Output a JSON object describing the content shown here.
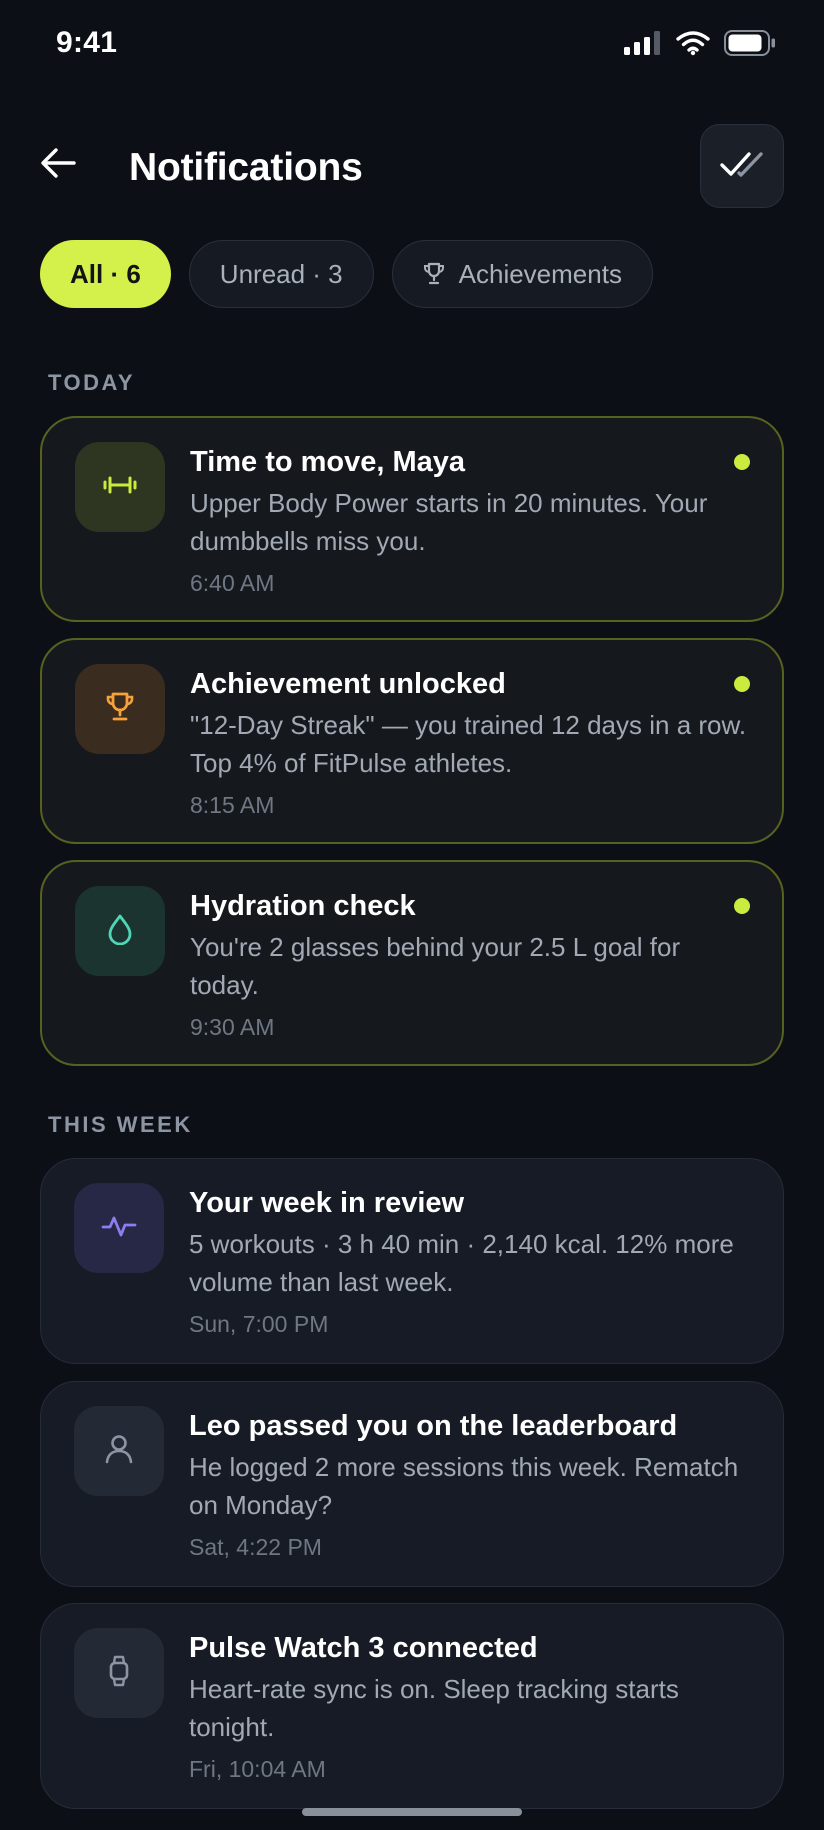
{
  "status_bar": {
    "time": "9:41",
    "icons": [
      "cellular-signal-icon",
      "wifi-icon",
      "battery-icon"
    ]
  },
  "header": {
    "title": "Notifications",
    "back_icon": "arrow-left-icon",
    "action_icon": "double-check-icon"
  },
  "filters": [
    {
      "label": "All · 6",
      "active": true
    },
    {
      "label": "Unread · 3",
      "active": false
    },
    {
      "label": "Achievements",
      "active": false,
      "icon": "trophy-icon"
    }
  ],
  "sections": {
    "today": {
      "label": "TODAY",
      "items": [
        {
          "title": "Time to move, Maya",
          "body": "Upper Body Power starts in 20 minutes. Your dumbbells miss you.",
          "time": "6:40 AM",
          "unread": true,
          "icon": "dumbbell-icon",
          "icon_color": "#c9ec3e"
        },
        {
          "title": "Achievement unlocked",
          "body": "\"12-Day Streak\" — you trained 12 days in a row. Top 4% of FitPulse athletes.",
          "time": "8:15 AM",
          "unread": true,
          "icon": "trophy-icon",
          "icon_color": "#f5a23a"
        },
        {
          "title": "Hydration check",
          "body": "You're 2 glasses behind your 2.5 L goal for today.",
          "time": "9:30 AM",
          "unread": true,
          "icon": "water-drop-icon",
          "icon_color": "#4fd6b4"
        }
      ]
    },
    "this_week": {
      "label": "THIS WEEK",
      "items": [
        {
          "title": "Your week in review",
          "body": "5 workouts · 3 h 40 min · 2,140 kcal. 12% more volume than last week.",
          "time": "Sun, 7:00 PM",
          "unread": false,
          "icon": "activity-pulse-icon",
          "icon_color": "#8f7cf0"
        },
        {
          "title": "Leo passed you on the leaderboard",
          "body": "He logged 2 more sessions this week. Rematch on Monday?",
          "time": "Sat, 4:22 PM",
          "unread": false,
          "icon": "user-icon",
          "icon_color": "#8d95a2"
        },
        {
          "title": "Pulse Watch 3 connected",
          "body": "Heart-rate sync is on. Sleep tracking starts tonight.",
          "time": "Fri, 10:04 AM",
          "unread": false,
          "icon": "watch-icon",
          "icon_color": "#8d95a2"
        }
      ]
    }
  },
  "colors": {
    "accent": "#d4f04a",
    "background": "#0c1016",
    "unread_border": "#56621f"
  }
}
